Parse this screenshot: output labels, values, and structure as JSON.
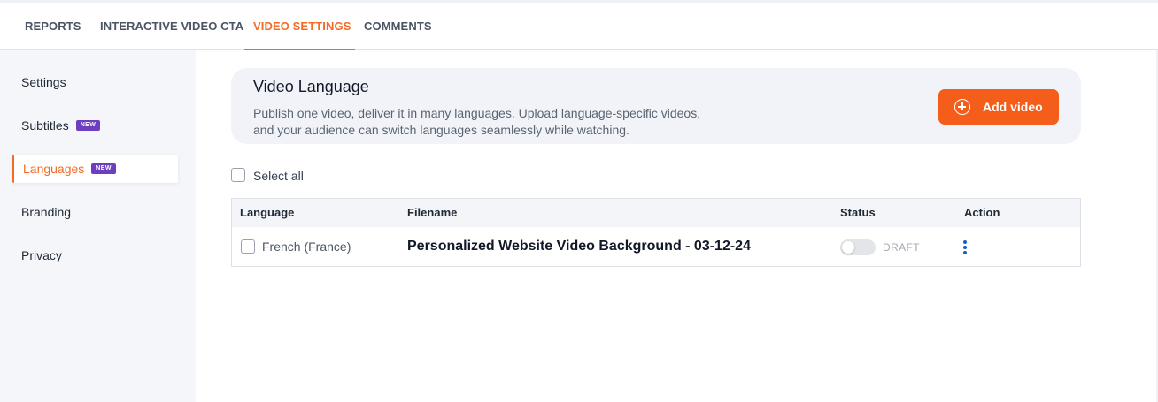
{
  "tabs": [
    {
      "label": "REPORTS",
      "active": false
    },
    {
      "label": "INTERACTIVE VIDEO CTA",
      "active": false
    },
    {
      "label": "VIDEO SETTINGS",
      "active": true
    },
    {
      "label": "COMMENTS",
      "active": false
    }
  ],
  "sidebar": {
    "items": [
      {
        "label": "Settings",
        "badge": ""
      },
      {
        "label": "Subtitles",
        "badge": "NEW"
      },
      {
        "label": "Languages",
        "badge": "NEW",
        "active": true
      },
      {
        "label": "Branding",
        "badge": ""
      },
      {
        "label": "Privacy",
        "badge": ""
      }
    ]
  },
  "banner": {
    "title": "Video Language",
    "description": "Publish one video, deliver it in many languages. Upload language-specific videos, and your audience can switch languages seamlessly while watching.",
    "add_button_label": "Add video"
  },
  "select_all_label": "Select all",
  "table": {
    "headers": {
      "language": "Language",
      "filename": "Filename",
      "status": "Status",
      "action": "Action"
    },
    "rows": [
      {
        "language": "French (France)",
        "filename": "Personalized Website Video Background - 03-12-24",
        "status": "DRAFT",
        "published": false
      }
    ]
  },
  "colors": {
    "accent": "#f46b25",
    "button": "#f45d1a",
    "badge": "#6d3fc0",
    "action_icon": "#1b5fc1"
  },
  "icons": {
    "add": "plus-circle-icon",
    "action": "more-vertical-icon"
  }
}
